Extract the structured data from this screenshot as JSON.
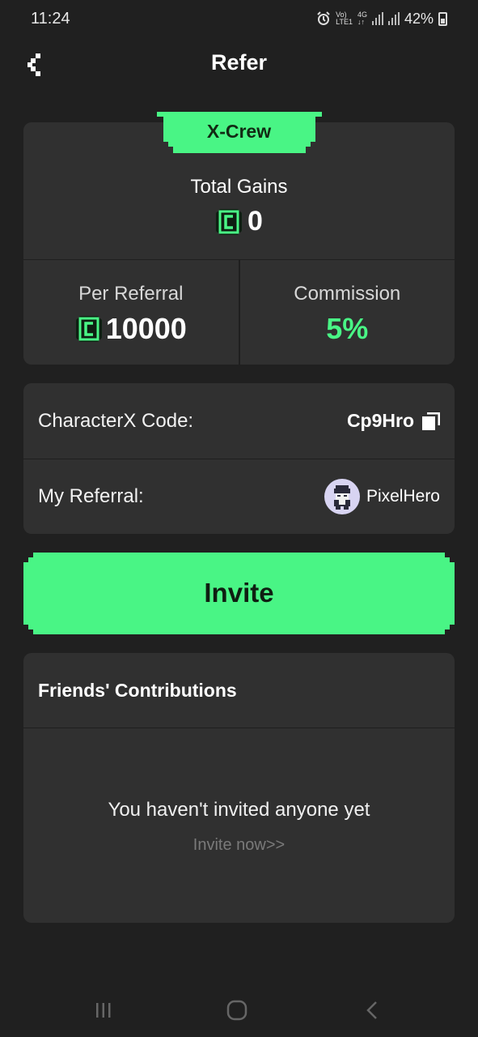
{
  "status_bar": {
    "time": "11:24",
    "network_top": "Vo)",
    "network_bottom": "LTE1",
    "net_type": "4G",
    "battery": "42%",
    "icons": [
      "alarm-icon",
      "signal-icon",
      "battery-icon"
    ]
  },
  "header": {
    "title": "Refer",
    "back_icon": "back-icon"
  },
  "gains": {
    "badge": "X-Crew",
    "total_label": "Total Gains",
    "total_value": "0",
    "per_referral_label": "Per Referral",
    "per_referral_value": "10000",
    "commission_label": "Commission",
    "commission_value": "5%",
    "coin_icon": "coin-icon"
  },
  "code": {
    "label": "CharacterX Code:",
    "value": "Cp9Hro",
    "copy_icon": "copy-icon"
  },
  "referral": {
    "label": "My Referral:",
    "name": "PixelHero",
    "avatar_icon": "pixel-avatar-icon"
  },
  "invite_button": {
    "label": "Invite"
  },
  "friends": {
    "title": "Friends' Contributions",
    "empty_text": "You haven't invited anyone yet",
    "invite_link": "Invite now>>"
  },
  "nav": {
    "icons": [
      "recent-apps-icon",
      "home-icon",
      "back-nav-icon"
    ]
  },
  "colors": {
    "background": "#202020",
    "card": "#303030",
    "accent": "#49f585"
  }
}
